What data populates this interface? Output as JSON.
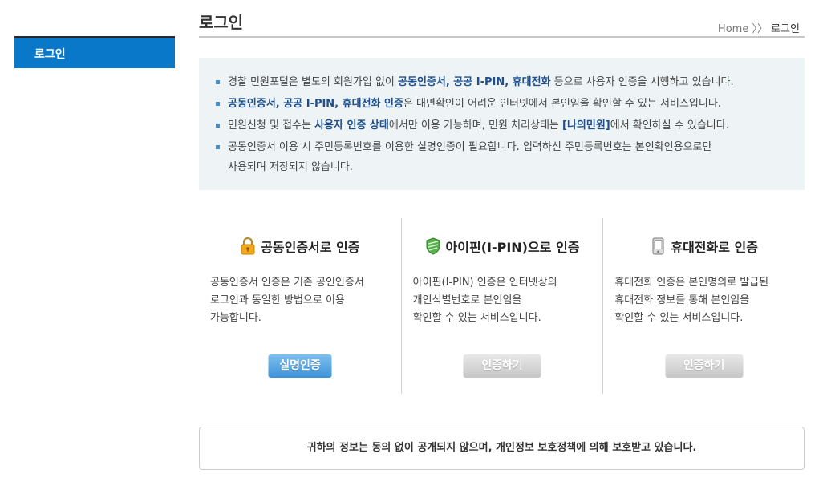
{
  "sidebar": {
    "items": [
      {
        "label": "로그인"
      }
    ]
  },
  "header": {
    "title": "로그인",
    "breadcrumb": {
      "home": "Home",
      "separator": "〉〉",
      "current": "로그인"
    }
  },
  "info": {
    "items": [
      {
        "parts": [
          "경찰 민원포털은 별도의 회원가입 없이 ",
          "공동인증서, 공공 I-PIN, 휴대전화",
          " 등으로 사용자 인증을 시행하고 있습니다."
        ]
      },
      {
        "parts": [
          "",
          "공동인증서, 공공 I-PIN, 휴대전화 인증",
          "은 대면확인이 어려운 인터넷에서 본인임을 확인할 수 있는 서비스입니다."
        ]
      },
      {
        "parts": [
          "민원신청 및 접수는 ",
          "사용자 인증 상태",
          "에서만 이용 가능하며, 민원 처리상태는 ",
          "[나의민원]",
          "에서 확인하실 수 있습니다."
        ]
      },
      {
        "line1": "공동인증서 이용 시 주민등록번호를 이용한 실명인증이 필요합니다. 입력하신 주민등록번호는 본인확인용으로만",
        "line2": "사용되며 저장되지 않습니다."
      }
    ]
  },
  "methods": [
    {
      "icon": "padlock-icon",
      "title": "공동인증서로 인증",
      "desc": [
        "공동인증서 인증은 기존 공인인증서",
        "로그인과 동일한 방법으로 이용",
        "가능합니다."
      ],
      "button": "실명인증"
    },
    {
      "icon": "shield-icon",
      "title": "아이핀(I-PIN)으로 인증",
      "desc": [
        "아이핀(I-PIN) 인증은 인터넷상의",
        "개인식별번호로 본인임을",
        "확인할 수 있는 서비스입니다."
      ],
      "button": "인증하기"
    },
    {
      "icon": "mobile-phone-icon",
      "title": "휴대전화로 인증",
      "desc": [
        "휴대전화 인증은 본인명의로 발급된",
        "휴대전화 정보를 통해 본인임을",
        "확인할 수 있는 서비스입니다."
      ],
      "button": "인증하기"
    }
  ],
  "notice": "귀하의 정보는 동의 없이 공개되지 않으며, 개인정보 보호정책에 의해 보호받고 있습니다.",
  "colors": {
    "accent": "#0a78c8",
    "info_bg": "#eef4f6",
    "emphasis": "#1e4f8a"
  }
}
